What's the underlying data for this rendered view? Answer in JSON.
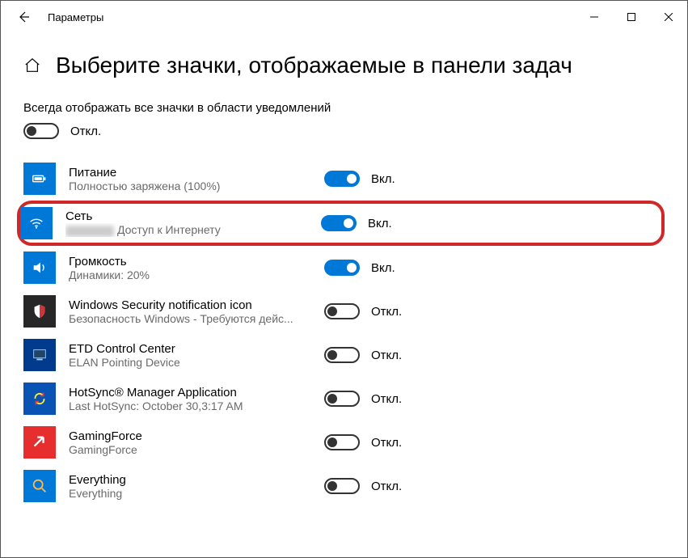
{
  "window": {
    "title": "Параметры"
  },
  "page": {
    "title": "Выберите значки, отображаемые в панели задач"
  },
  "master": {
    "label": "Всегда отображать все значки в области уведомлений",
    "state": false,
    "state_label": "Откл."
  },
  "items": [
    {
      "title": "Питание",
      "sub": "Полностью заряжена (100%)",
      "on": true,
      "state_label": "Вкл.",
      "icon": "battery",
      "style": "blue"
    },
    {
      "title": "Сеть",
      "sub": "Доступ к Интернету",
      "on": true,
      "state_label": "Вкл.",
      "icon": "wifi",
      "style": "blue",
      "hl": true,
      "blur_prefix": true
    },
    {
      "title": "Громкость",
      "sub": "Динамики: 20%",
      "on": true,
      "state_label": "Вкл.",
      "icon": "volume",
      "style": "blue"
    },
    {
      "title": "Windows Security notification icon",
      "sub": "Безопасность Windows - Требуются дейс...",
      "on": false,
      "state_label": "Откл.",
      "icon": "shield",
      "style": "sec"
    },
    {
      "title": "ETD Control Center",
      "sub": "ELAN Pointing Device",
      "on": false,
      "state_label": "Откл.",
      "icon": "monitor",
      "style": "darkblue"
    },
    {
      "title": "HotSync® Manager Application",
      "sub": "Last HotSync: October 30,3:17 AM",
      "on": false,
      "state_label": "Откл.",
      "icon": "sync",
      "style": "blue2"
    },
    {
      "title": "GamingForce",
      "sub": "GamingForce",
      "on": false,
      "state_label": "Откл.",
      "icon": "arrow",
      "style": "red2"
    },
    {
      "title": "Everything",
      "sub": "Everything",
      "on": false,
      "state_label": "Откл.",
      "icon": "search",
      "style": "blue"
    }
  ]
}
